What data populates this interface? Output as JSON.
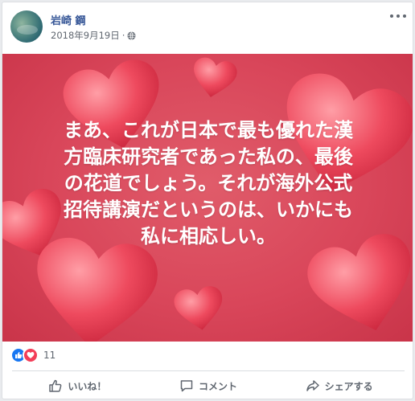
{
  "post": {
    "author": "岩崎 鋼",
    "date": "2018年9月19日",
    "separator": "·",
    "text": "まあ、これが日本で最も優れた漢\n方臨床研究者であった私の、最後\nの花道でしょう。それが海外公式\n招待講演だというのは、いかにも\n私に相応しい。",
    "background_color": "#d9465a"
  },
  "reactions": {
    "count": "11",
    "icons": [
      "like-icon",
      "love-icon"
    ]
  },
  "actions": {
    "like": "いいね！",
    "comment": "コメント",
    "share": "シェアする"
  },
  "icons": {
    "privacy": "globe-icon",
    "menu": "more-options-icon"
  },
  "colors": {
    "author_link": "#385898",
    "meta_text": "#606770",
    "like_blue": "#1877f2",
    "love_red": "#f33e58"
  }
}
